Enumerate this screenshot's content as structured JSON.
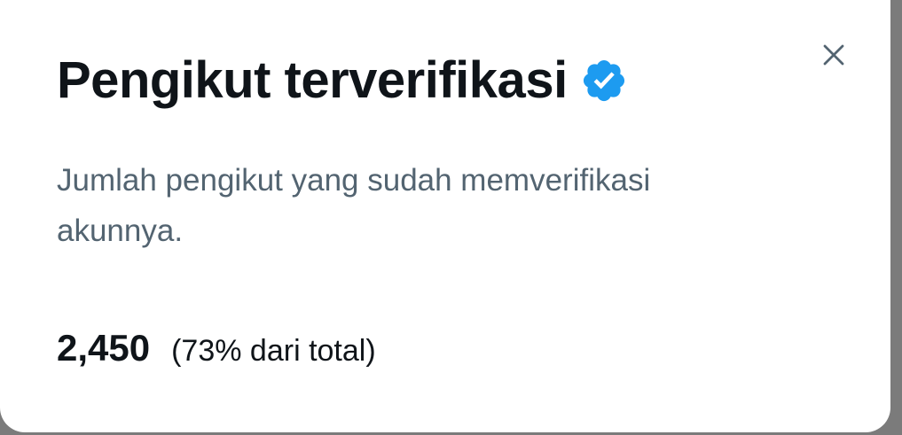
{
  "dialog": {
    "title": "Pengikut terverifikasi",
    "badge_icon": "verified-badge-icon",
    "close_icon": "close-icon",
    "description": "Jumlah pengikut yang sudah memverifikasi akunnya.",
    "count": "2,450",
    "percentage_text": "(73% dari total)"
  },
  "colors": {
    "title": "#0f1419",
    "description": "#536471",
    "badge": "#1d9bf0",
    "close": "#536471",
    "backdrop": "#7b7b7b"
  }
}
